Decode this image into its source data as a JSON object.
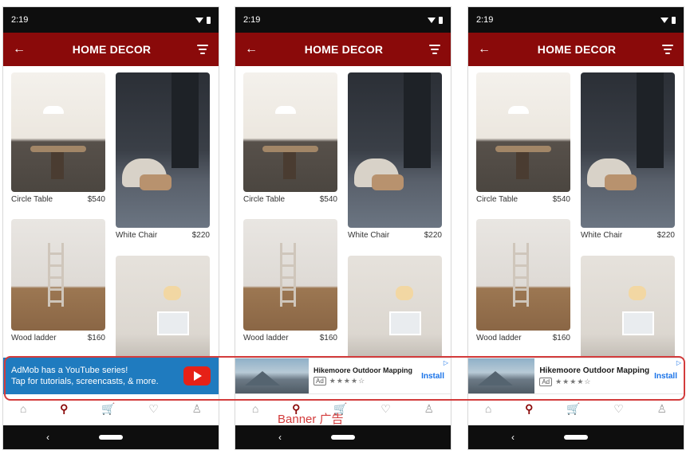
{
  "status": {
    "time": "2:19"
  },
  "appbar": {
    "title": "HOME DECOR"
  },
  "products": [
    {
      "name": "Circle Table",
      "price": "$540"
    },
    {
      "name": "White Chair",
      "price": "$220"
    },
    {
      "name": "Wood ladder",
      "price": "$160"
    },
    {
      "name": "",
      "price": ""
    }
  ],
  "ads": {
    "youtube_promo": {
      "line1": "AdMob has a YouTube series!",
      "line2": "Tap for tutorials, screencasts, & more."
    },
    "native_ad": {
      "title": "Hikemoore Outdoor Mapping",
      "badge": "Ad",
      "stars": "★★★★☆",
      "cta": "Install",
      "adchoices": "▷"
    }
  },
  "bottom_nav": {
    "icons": [
      "home-icon",
      "search-icon",
      "cart-icon",
      "heart-icon",
      "profile-icon"
    ]
  },
  "annotation": {
    "label": "Banner 广告"
  },
  "colors": {
    "primary": "#8a0a0a",
    "ad_blue": "#1f7bbf",
    "highlight": "#d33c3c"
  }
}
